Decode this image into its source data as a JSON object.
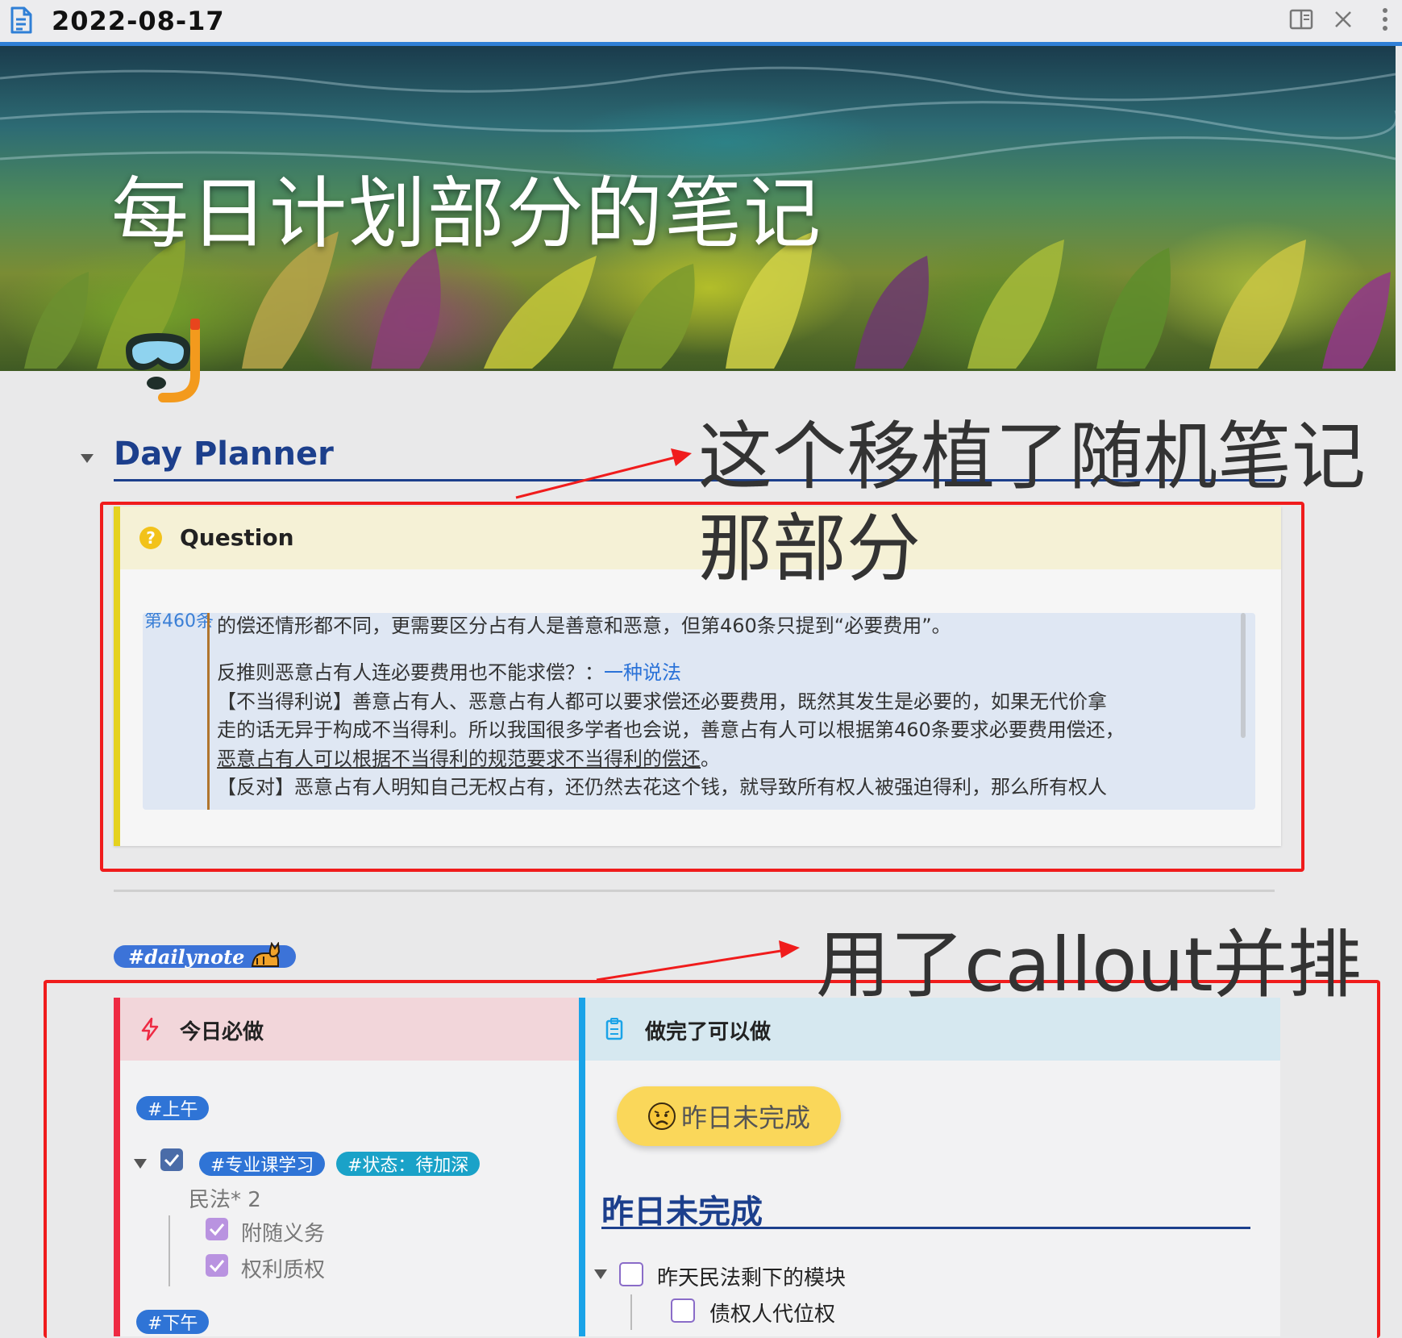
{
  "window": {
    "title": "2022-08-17",
    "icons": [
      "document-icon",
      "split-view-icon",
      "close-icon",
      "more-icon"
    ]
  },
  "banner": {
    "title": "每日计划部分的笔记"
  },
  "sections": {
    "day_planner": "Day Planner",
    "yesterday_heading": "昨日未完成"
  },
  "annotations": {
    "top_line1": "这个移植了随机笔记",
    "top_line2": "那部分",
    "bottom": "用了callout并排"
  },
  "question_callout": {
    "title": "Question",
    "hidden_fragment": "第460条",
    "lines": [
      "的偿还情形都不同，更需要区分占有人是善意和恶意，但第460条只提到“必要费用”。",
      "反推则恶意占有人连必要费用也不能求偿？：",
      "一种说法",
      "【不当得利说】善意占有人、恶意占有人都可以要求偿还必要费用，既然其发生是必要的，如果无代价拿",
      "走的话无异于构成不当得利。所以我国很多学者也会说，善意占有人可以根据第460条要求必要费用偿还，",
      "恶意占有人可以根据不当得利的规范要求不当得利的偿还",
      "。",
      "【反对】恶意占有人明知自己无权占有，还仍然去花这个钱，就导致所有权人被强迫得利，那么所有权人"
    ]
  },
  "daily_tag": "#dailynote",
  "left_callout": {
    "title": "今日必做",
    "morning_tag": "#上午",
    "task_tags": [
      "#专业课学习",
      "#状态：待加深"
    ],
    "subject": "民法* 2",
    "subtasks": [
      "附随义务",
      "权利质权"
    ],
    "afternoon_tag": "#下午"
  },
  "right_callout": {
    "title": "做完了可以做",
    "button": "昨日未完成",
    "tasks": [
      "昨天民法剩下的模块",
      "债权人代位权"
    ]
  },
  "colors": {
    "accent_blue": "#2f7fd6",
    "heading_blue": "#1c3f8c",
    "annotation_red": "#f01c1c",
    "question_yellow": "#e5d21e",
    "left_red": "#ee2a43",
    "right_blue": "#1aa3e8"
  }
}
